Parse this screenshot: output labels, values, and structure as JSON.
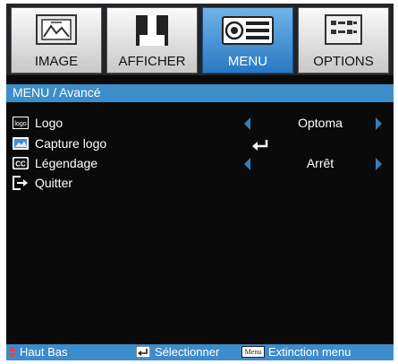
{
  "tabs": [
    {
      "label": "IMAGE",
      "icon": "image-icon",
      "active": false
    },
    {
      "label": "AFFICHER",
      "icon": "display-icon",
      "active": false
    },
    {
      "label": "MENU",
      "icon": "projector-icon",
      "active": true
    },
    {
      "label": "OPTIONS",
      "icon": "options-icon",
      "active": false
    }
  ],
  "breadcrumb": "MENU / Avancé",
  "items": [
    {
      "label": "Logo",
      "icon": "logo-icon",
      "value": "Optoma",
      "control": "arrows"
    },
    {
      "label": "Capture logo",
      "icon": "capture-icon",
      "value": "",
      "control": "enter"
    },
    {
      "label": "Légendage",
      "icon": "cc-icon",
      "value": "Arrêt",
      "control": "arrows"
    },
    {
      "label": "Quitter",
      "icon": "exit-icon",
      "value": "",
      "control": "none"
    }
  ],
  "footer": {
    "nav": "Haut Bas",
    "select": "Sélectionner",
    "menu_key": "Menu",
    "exit": "Extinction menu"
  },
  "colors": {
    "accent": "#3b8ec9",
    "arrow": "#2f7fc0",
    "background": "#0a0a0a"
  }
}
